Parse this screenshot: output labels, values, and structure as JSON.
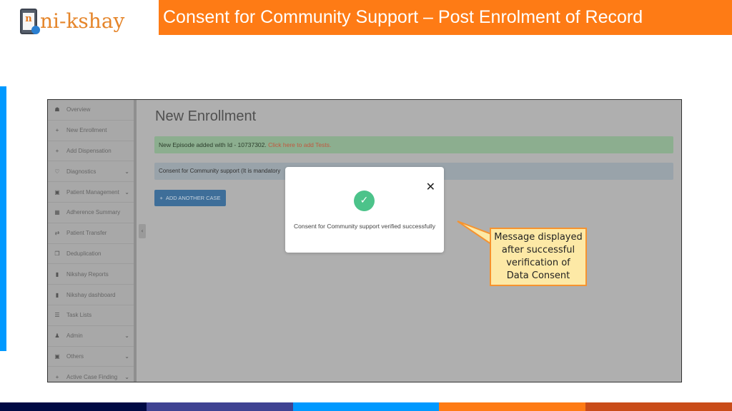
{
  "slide": {
    "title": "Consent for Community Support – Post Enrolment of Record",
    "logo_text": "ni-kshay",
    "logo_letter": "n"
  },
  "sidebar": {
    "items": [
      {
        "label": "Overview",
        "icon": "dashboard-icon",
        "glyph": "☗",
        "has_submenu": false
      },
      {
        "label": "New Enrollment",
        "icon": "plus-icon",
        "glyph": "+",
        "has_submenu": false
      },
      {
        "label": "Add Dispensation",
        "icon": "plus-icon",
        "glyph": "+",
        "has_submenu": false
      },
      {
        "label": "Diagnostics",
        "icon": "stethoscope-icon",
        "glyph": "♡",
        "has_submenu": true
      },
      {
        "label": "Patient Management",
        "icon": "briefcase-icon",
        "glyph": "▣",
        "has_submenu": true
      },
      {
        "label": "Adherence Summary",
        "icon": "calendar-icon",
        "glyph": "▦",
        "has_submenu": false
      },
      {
        "label": "Patient Transfer",
        "icon": "transfer-icon",
        "glyph": "⇄",
        "has_submenu": false
      },
      {
        "label": "Deduplication",
        "icon": "copy-icon",
        "glyph": "❐",
        "has_submenu": false
      },
      {
        "label": "Nikshay Reports",
        "icon": "file-icon",
        "glyph": "▮",
        "has_submenu": false
      },
      {
        "label": "Nikshay dashboard",
        "icon": "file-icon",
        "glyph": "▮",
        "has_submenu": false
      },
      {
        "label": "Task Lists",
        "icon": "list-icon",
        "glyph": "☰",
        "has_submenu": false
      },
      {
        "label": "Admin",
        "icon": "user-icon",
        "glyph": "♟",
        "has_submenu": true
      },
      {
        "label": "Others",
        "icon": "briefcase-icon",
        "glyph": "▣",
        "has_submenu": true
      },
      {
        "label": "Active Case Finding",
        "icon": "plus-icon",
        "glyph": "+",
        "has_submenu": true
      }
    ],
    "chevron_glyph": "⌄",
    "collapse_glyph": "‹"
  },
  "main": {
    "page_title": "New Enrollment",
    "success_alert": {
      "text": "New Episode added with Id - 10737302. ",
      "link": "Click here to add Tests."
    },
    "info_alert": {
      "text": "Consent for Community support (It is mandatory"
    },
    "add_button": {
      "icon_glyph": "+",
      "label": "ADD ANOTHER CASE"
    }
  },
  "modal": {
    "close_glyph": "✕",
    "check_glyph": "✓",
    "message": "Consent for Community support verified successfully"
  },
  "callout": {
    "text": "Message displayed after successful verification of Data Consent"
  },
  "colors": {
    "header_orange": "#fe7b15",
    "accent_blue": "#0099ff",
    "success_check": "#4cc38a",
    "callout_fill": "#fde9a6",
    "callout_border": "#f6932f",
    "stripes": [
      "#000a44",
      "#3f4392",
      "#0099ff",
      "#fe7b15",
      "#c94c19"
    ]
  }
}
